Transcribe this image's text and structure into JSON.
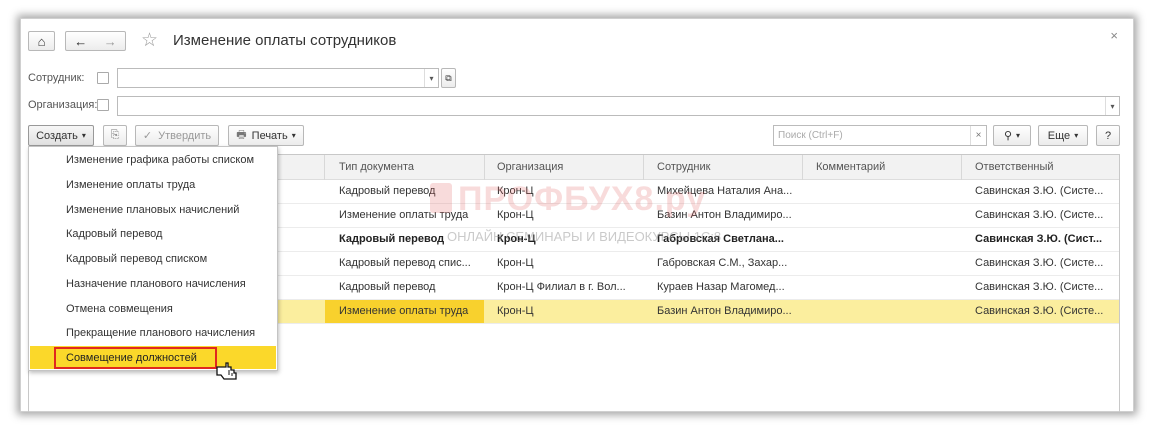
{
  "window": {
    "title": "Изменение оплаты сотрудников",
    "close": "×"
  },
  "nav": {
    "home": "⌂",
    "back": "←",
    "forward": "→",
    "star": "☆"
  },
  "filters": {
    "employee_label": "Сотрудник:",
    "organization_label": "Организация:"
  },
  "toolbar": {
    "create": "Создать",
    "approve": "Утвердить",
    "print": "Печать",
    "search_placeholder": "Поиск (Ctrl+F)",
    "search_clear": "×",
    "search_icon": "magnifier-icon",
    "more": "Еще",
    "help": "?"
  },
  "columns": [
    "Тип документа",
    "Организация",
    "Сотрудник",
    "Комментарий",
    "Ответственный"
  ],
  "rows": [
    {
      "type": "Кадровый перевод",
      "org": "Крон-Ц",
      "employee": "Михейцева Наталия Ана...",
      "comment": "",
      "resp": "Савинская З.Ю. (Систе...",
      "bold": false,
      "selected": false
    },
    {
      "type": "Изменение оплаты труда",
      "org": "Крон-Ц",
      "employee": "Базин Антон Владимиро...",
      "comment": "",
      "resp": "Савинская З.Ю. (Систе...",
      "bold": false,
      "selected": false
    },
    {
      "type": "Кадровый перевод",
      "org": "Крон-Ц",
      "employee": "Габровская Светлана...",
      "comment": "",
      "resp": "Савинская З.Ю. (Сист...",
      "bold": true,
      "selected": false
    },
    {
      "type": "Кадровый перевод спис...",
      "org": "Крон-Ц",
      "employee": "Габровская С.М., Захар...",
      "comment": "",
      "resp": "Савинская З.Ю. (Систе...",
      "bold": false,
      "selected": false
    },
    {
      "type": "Кадровый перевод",
      "org": "Крон-Ц  Филиал в г. Вол...",
      "employee": "Кураев Назар Магомед...",
      "comment": "",
      "resp": "Савинская З.Ю. (Систе...",
      "bold": false,
      "selected": false
    },
    {
      "type": "Изменение оплаты труда",
      "org": "Крон-Ц",
      "employee": "Базин Антон Владимиро...",
      "comment": "",
      "resp": "Савинская З.Ю. (Систе...",
      "bold": false,
      "selected": true
    }
  ],
  "create_menu": [
    "Изменение графика работы списком",
    "Изменение оплаты труда",
    "Изменение плановых начислений",
    "Кадровый перевод",
    "Кадровый перевод списком",
    "Назначение планового начисления",
    "Отмена совмещения",
    "Прекращение планового начисления",
    "Совмещение должностей"
  ],
  "watermark": {
    "main": "ПРОФБУХ8.ру",
    "sub": "ОНЛАЙН СЕМИНАРЫ И ВИДЕОКУРСЫ 1С:8"
  },
  "colors": {
    "selection": "#f8d12d",
    "row_highlight": "#fbee9e",
    "menu_highlight_border": "#e0281f"
  }
}
